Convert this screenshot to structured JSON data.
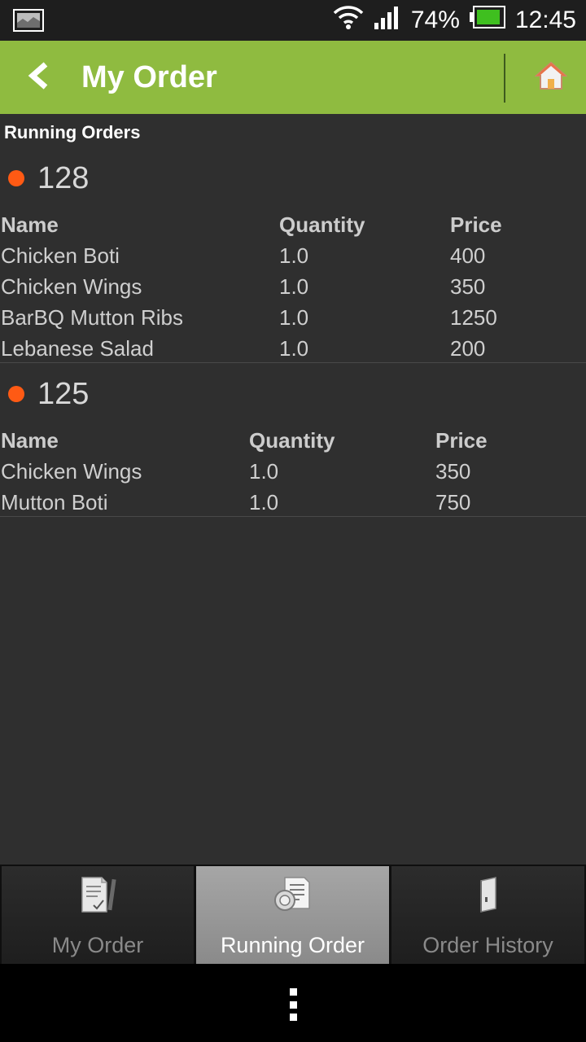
{
  "status_bar": {
    "battery_percent": "74%",
    "time": "12:45",
    "signal_bars": 4,
    "battery_level": 0.74,
    "battery_color": "#3fbf1f"
  },
  "action_bar": {
    "title": "My Order",
    "back_icon": "chevron-left-icon",
    "home_icon": "home-icon",
    "accent_color": "#8fbb40"
  },
  "section_title": "Running Orders",
  "orders": [
    {
      "number": "128",
      "columns": [
        "Name",
        "Quantity",
        "Price"
      ],
      "items": [
        {
          "name": "Chicken Boti",
          "quantity": "1.0",
          "price": "400"
        },
        {
          "name": "Chicken Wings",
          "quantity": "1.0",
          "price": "350"
        },
        {
          "name": "BarBQ Mutton Ribs",
          "quantity": "1.0",
          "price": "1250"
        },
        {
          "name": "Lebanese Salad",
          "quantity": "1.0",
          "price": "200"
        }
      ]
    },
    {
      "number": "125",
      "columns": [
        "Name",
        "Quantity",
        "Price"
      ],
      "items": [
        {
          "name": "Chicken Wings",
          "quantity": "1.0",
          "price": "350"
        },
        {
          "name": "Mutton Boti",
          "quantity": "1.0",
          "price": "750"
        }
      ]
    }
  ],
  "tabs": [
    {
      "label": "My Order",
      "icon": "order-document-icon",
      "selected": false
    },
    {
      "label": "Running Order",
      "icon": "running-order-icon",
      "selected": true
    },
    {
      "label": "Order History",
      "icon": "order-history-icon",
      "selected": false
    }
  ],
  "system_nav": {
    "menu_icon": "overflow-menu-icon"
  }
}
